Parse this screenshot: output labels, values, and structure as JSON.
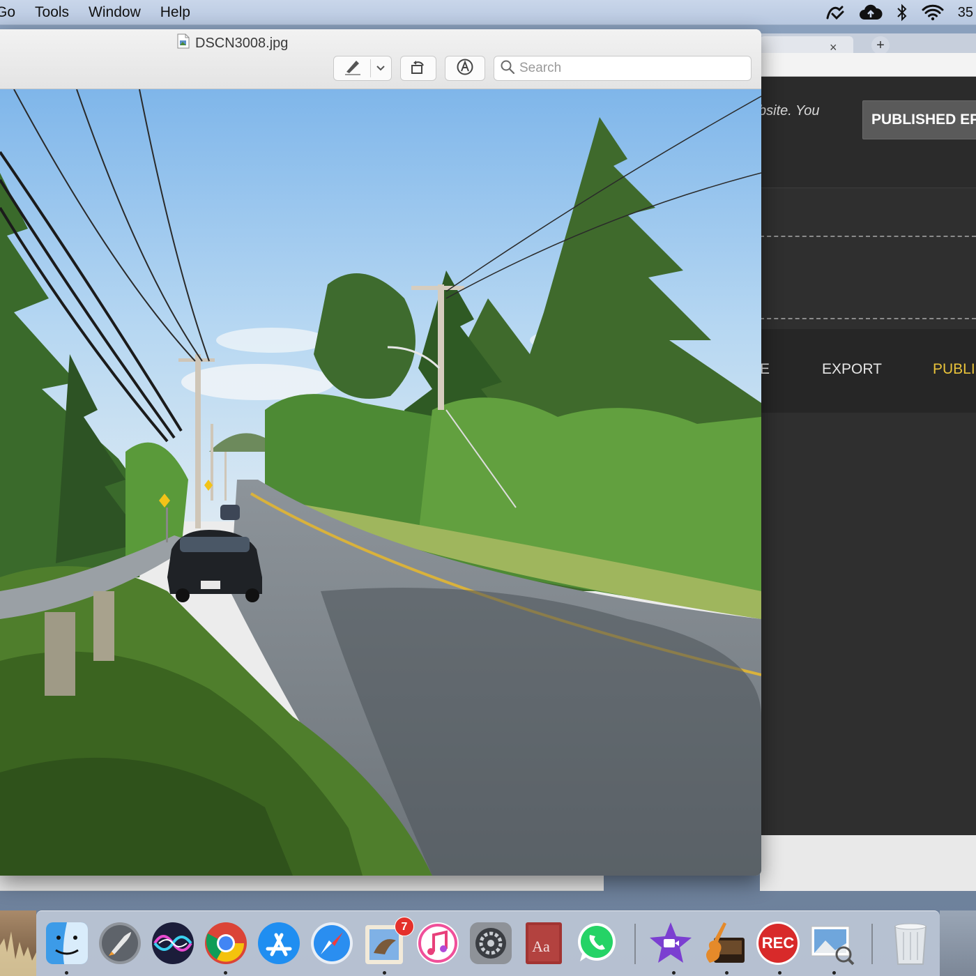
{
  "menubar": {
    "menus": [
      "Go",
      "Tools",
      "Window",
      "Help"
    ],
    "battery_text": "35",
    "status_icons": [
      "pen-tablet-icon",
      "cloud-upload-icon",
      "bluetooth-icon",
      "wifi-icon"
    ]
  },
  "preview_window": {
    "title": "DSCN3008.jpg",
    "file_icon": "jpeg-file-icon",
    "toolbar": {
      "markup_icon": "pen-icon",
      "dropdown_icon": "chevron-down-icon",
      "rotate_icon": "rotate-icon",
      "annotate_icon": "markup-circle-icon",
      "search_placeholder": "Search"
    },
    "image_description_icon": "photo"
  },
  "browser_window": {
    "tab_close": "×",
    "tab_new": "+",
    "site_text": "bsite. You",
    "published_button": "PUBLISHED EP",
    "nav": {
      "partial_item": "E",
      "export": "EXPORT",
      "publish": "PUBLI"
    },
    "accent_color": "#e8c23a"
  },
  "dock": {
    "apps": [
      {
        "name": "Finder",
        "icon": "finder-icon",
        "running": true
      },
      {
        "name": "Launchpad",
        "icon": "launchpad-icon",
        "running": false
      },
      {
        "name": "Siri",
        "icon": "siri-icon",
        "running": false
      },
      {
        "name": "Google Chrome",
        "icon": "chrome-icon",
        "running": true
      },
      {
        "name": "App Store",
        "icon": "app-store-icon",
        "running": false
      },
      {
        "name": "Safari",
        "icon": "safari-icon",
        "running": false
      },
      {
        "name": "Mail",
        "icon": "mail-icon",
        "running": true,
        "badge": "7"
      },
      {
        "name": "iTunes",
        "icon": "itunes-icon",
        "running": false
      },
      {
        "name": "System Preferences",
        "icon": "system-preferences-icon",
        "running": false
      },
      {
        "name": "Dictionary",
        "icon": "dictionary-icon",
        "running": false,
        "label": "Aa"
      },
      {
        "name": "WhatsApp",
        "icon": "whatsapp-icon",
        "running": false
      },
      {
        "name": "iMovie",
        "icon": "imovie-icon",
        "running": true
      },
      {
        "name": "GarageBand",
        "icon": "garageband-icon",
        "running": true
      },
      {
        "name": "Screen Recorder",
        "icon": "rec-icon",
        "running": true,
        "label": "REC"
      },
      {
        "name": "Preview",
        "icon": "preview-icon",
        "running": true
      },
      {
        "name": "Trash",
        "icon": "trash-icon",
        "running": false
      }
    ]
  }
}
